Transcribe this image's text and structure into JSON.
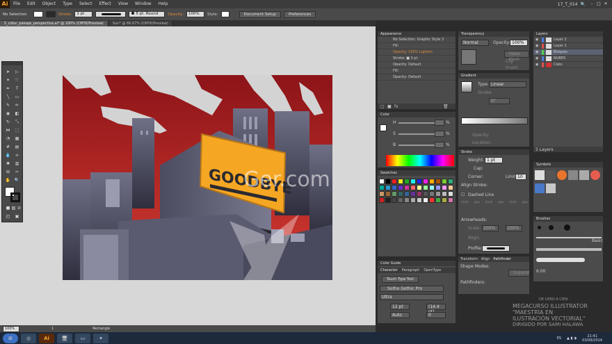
{
  "menubar": {
    "logo": "Ai",
    "items": [
      "File",
      "Edit",
      "Object",
      "Type",
      "Select",
      "Effect",
      "View",
      "Window",
      "Help"
    ],
    "workspace": "17_T_014",
    "win_min": "–",
    "win_max": "□",
    "win_close": "✕"
  },
  "controlbar": {
    "selection": "No Selection",
    "stroke_label": "Stroke:",
    "stroke_weight": "1 pt",
    "brush": "5 pt. Round",
    "opacity_label": "Opacity:",
    "opacity_value": "100%",
    "style_label": "Style:",
    "doc_setup": "Document Setup",
    "preferences": "Preferences"
  },
  "tabs": [
    {
      "label": "5_ciduc_paisaje_perspectiva.ai* @ 100% (CMYK/Preview)",
      "active": true
    },
    {
      "label": "Sun* @ 66.67% (CMYK/Preview)",
      "active": false
    }
  ],
  "artwork": {
    "billboard_text": "GOODBYE",
    "sky_top": "#8c1418",
    "sky_bottom": "#d63b32",
    "building_color": "#5a5a6e",
    "billboard_color": "#f5a623"
  },
  "watermark": {
    "center": "Ger.com",
    "line1": "MEGACURSO ILLUSTRATOR",
    "line2": "\"MAESTRÍA EN",
    "line3": "ILUSTRACIÓN VECTORIAL\"",
    "line4": "DIRIGIDO POR SAMI HALAWA",
    "small": "DE CERO A CIEN"
  },
  "appearance": {
    "title": "Appearance",
    "header": "No Selection: Graphic Style 3",
    "rows": [
      "Fill:",
      "Opacity: 100% Lighten",
      "Stroke: ■ 3 pt",
      "Opacity: Default",
      "Fill:",
      "Opacity: Default"
    ]
  },
  "transparency": {
    "title": "Transparency",
    "mode": "Normal",
    "opacity_label": "Opacity:",
    "opacity": "100%",
    "make_mask": "Make Mask",
    "clip": "Clip",
    "invert": "Invert Mask"
  },
  "gradient": {
    "title": "Gradient",
    "type_label": "Type:",
    "type": "Linear",
    "stroke_label": "Stroke:",
    "angle": "0°",
    "opacity_label": "Opacity:",
    "location_label": "Location:"
  },
  "color": {
    "title": "Color",
    "channels": [
      "H",
      "S",
      "B"
    ],
    "pct": "%"
  },
  "swatches": {
    "title": "Swatches"
  },
  "stroke": {
    "title": "Stroke",
    "weight_label": "Weight:",
    "weight": "1 pt",
    "cap_label": "Cap:",
    "corner_label": "Corner:",
    "limit_label": "Limit:",
    "limit": "10",
    "align_label": "Align Stroke:",
    "dashed": "Dashed Line",
    "dash_labels": [
      "dash",
      "gap",
      "dash",
      "gap",
      "dash",
      "gap"
    ],
    "arrowheads": "Arrowheads:",
    "scale": "Scale:",
    "scale_val": "100%",
    "align": "Align:",
    "profile": "Profile:"
  },
  "layers": {
    "title": "Layers",
    "items": [
      {
        "name": "Layer 2",
        "color": "#4f7de0"
      },
      {
        "name": "Layer 1",
        "color": "#e04f4f"
      },
      {
        "name": "Bloques",
        "color": "#4fd04f"
      },
      {
        "name": "NUBES",
        "color": "#4f7de0"
      },
      {
        "name": "Cielo",
        "color": "#e04f4f"
      }
    ],
    "footer": "5 Layers"
  },
  "symbols": {
    "title": "Symbols"
  },
  "brushes": {
    "title": "Brushes",
    "basic": "Basic",
    "size": "6.00"
  },
  "color_guide": {
    "title": "Color Guide"
  },
  "character": {
    "tabs": [
      "Character",
      "Paragraph",
      "OpenType"
    ],
    "touch": "Touch Type Tool",
    "font": "Sotho Gothic Pro",
    "style": "Ultra",
    "size": "12 pt",
    "leading": "(14.4 pt)",
    "kerning": "Auto",
    "tracking": "0"
  },
  "pathfinder": {
    "tabs": [
      "Transform",
      "Align",
      "Pathfinder"
    ],
    "shape_modes": "Shape Modes:",
    "pathfinders": "Pathfinders:",
    "expand": "Expand"
  },
  "statusbar": {
    "zoom": "100%",
    "page": "1",
    "tool": "Rectangle"
  },
  "taskbar": {
    "lang": "ES",
    "time": "21:41",
    "date": "03/09/2014"
  }
}
